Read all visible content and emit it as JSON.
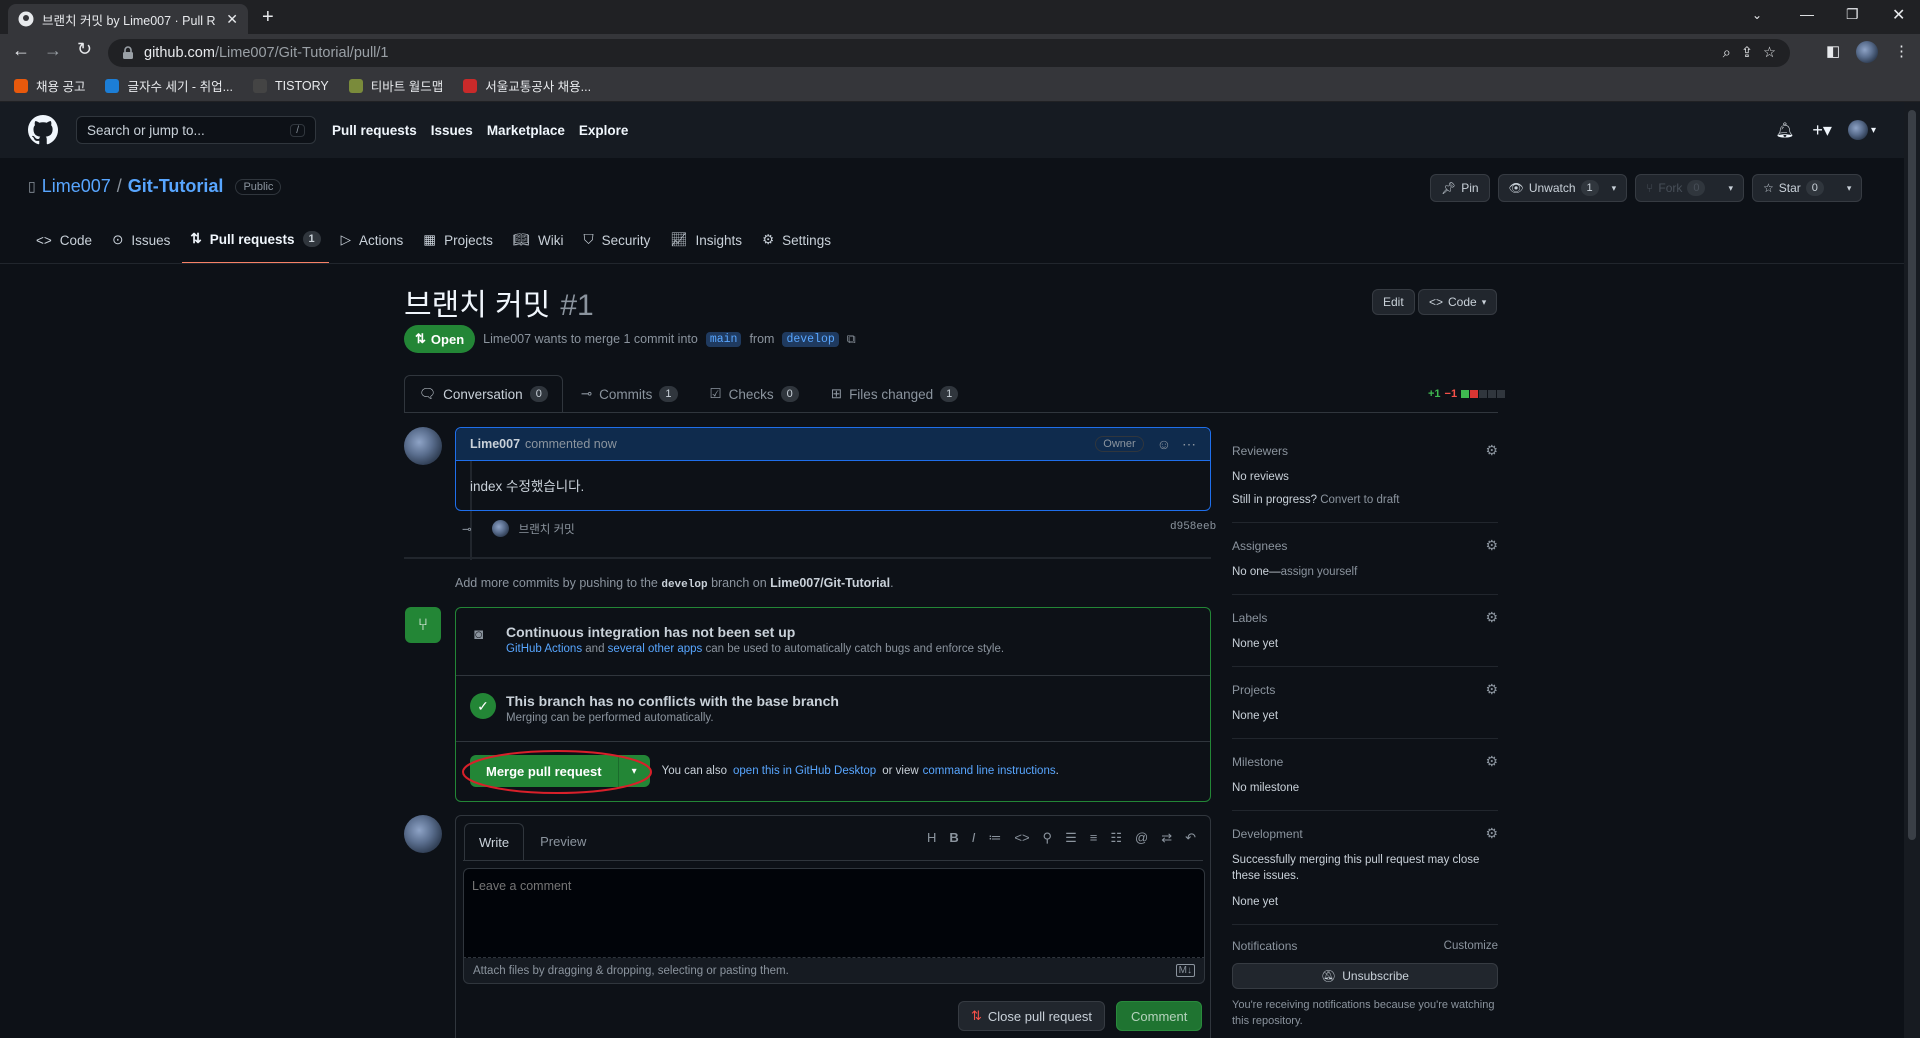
{
  "browser": {
    "tab_title": "브랜치 커밋 by Lime007 · Pull R",
    "url_host": "github.com",
    "url_path": "/Lime007/Git-Tutorial/pull/1",
    "bookmarks": [
      {
        "label": "채용 공고",
        "color": "#e8590c"
      },
      {
        "label": "글자수 세기 - 취업...",
        "color": "#1c7ed6"
      },
      {
        "label": "TISTORY",
        "color": "#444"
      },
      {
        "label": "티바트 월드맵",
        "color": "#7a8b3b"
      },
      {
        "label": "서울교통공사 채용...",
        "color": "#c92a2a"
      }
    ]
  },
  "gh": {
    "search_placeholder": "Search or jump to...",
    "search_key": "/",
    "nav": [
      "Pull requests",
      "Issues",
      "Marketplace",
      "Explore"
    ]
  },
  "repo": {
    "owner": "Lime007",
    "sep": "/",
    "name": "Git-Tutorial",
    "visibility": "Public",
    "pin": "Pin",
    "unwatch": "Unwatch",
    "unwatch_count": "1",
    "fork": "Fork",
    "fork_count": "0",
    "star": "Star",
    "star_count": "0",
    "tabs": [
      {
        "label": "Code"
      },
      {
        "label": "Issues"
      },
      {
        "label": "Pull requests",
        "count": "1"
      },
      {
        "label": "Actions"
      },
      {
        "label": "Projects"
      },
      {
        "label": "Wiki"
      },
      {
        "label": "Security"
      },
      {
        "label": "Insights"
      },
      {
        "label": "Settings"
      }
    ]
  },
  "pr": {
    "title": "브랜치 커밋",
    "number": "#1",
    "edit": "Edit",
    "code": "Code",
    "state": "Open",
    "meta_author": "Lime007",
    "meta_text": "wants to merge 1 commit into",
    "base": "main",
    "from": "from",
    "head": "develop",
    "tabs": [
      {
        "label": "Conversation",
        "count": "0"
      },
      {
        "label": "Commits",
        "count": "1"
      },
      {
        "label": "Checks",
        "count": "0"
      },
      {
        "label": "Files changed",
        "count": "1"
      }
    ],
    "additions": "+1",
    "deletions": "−1",
    "comment": {
      "author": "Lime007",
      "when": "commented now",
      "role": "Owner",
      "body": "index 수정했습니다."
    },
    "commit": {
      "message": "브랜치 커밋",
      "sha": "d958eeb"
    },
    "push_hint": {
      "a": "Add more commits by pushing to the",
      "branch": "develop",
      "b": "branch on",
      "repo": "Lime007/Git-Tutorial",
      "c": "."
    },
    "ci": {
      "title": "Continuous integration has not been set up",
      "link1": "GitHub Actions",
      "and": "and",
      "link2": "several other apps",
      "rest": "can be used to automatically catch bugs and enforce style."
    },
    "conflicts": {
      "title": "This branch has no conflicts with the base branch",
      "sub": "Merging can be performed automatically."
    },
    "merge": {
      "button": "Merge pull request",
      "also": "You can also",
      "link1": "open this in GitHub Desktop",
      "or": "or view",
      "link2": "command line instructions",
      "end": "."
    },
    "editor": {
      "write": "Write",
      "preview": "Preview",
      "placeholder": "Leave a comment",
      "attach": "Attach files by dragging & dropping, selecting or pasting them.",
      "close": "Close pull request",
      "submit": "Comment"
    }
  },
  "sidebar": {
    "reviewers": {
      "title": "Reviewers",
      "value": "No reviews",
      "progress": "Still in progress?",
      "draft": "Convert to draft"
    },
    "assignees": {
      "title": "Assignees",
      "value": "No one—",
      "link": "assign yourself"
    },
    "labels": {
      "title": "Labels",
      "value": "None yet"
    },
    "projects": {
      "title": "Projects",
      "value": "None yet"
    },
    "milestone": {
      "title": "Milestone",
      "value": "No milestone"
    },
    "development": {
      "title": "Development",
      "desc": "Successfully merging this pull request may close these issues.",
      "value": "None yet"
    },
    "notifications": {
      "title": "Notifications",
      "customize": "Customize",
      "button": "Unsubscribe",
      "desc": "You're receiving notifications because you're watching this repository."
    }
  },
  "colors": {
    "green": "#238636",
    "accent": "#58a6ff",
    "annotation": "#d9202a"
  }
}
